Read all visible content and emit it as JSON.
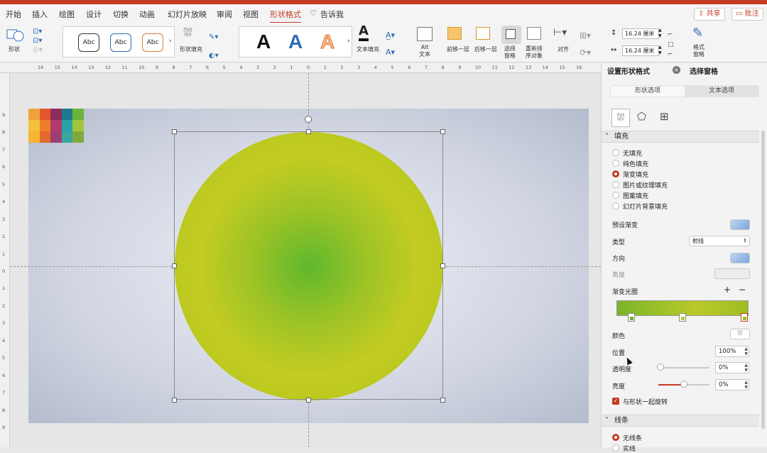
{
  "menu": {
    "tabs": [
      "开始",
      "插入",
      "绘图",
      "设计",
      "切换",
      "动画",
      "幻灯片放映",
      "审阅",
      "视图",
      "形状格式",
      "告诉我"
    ],
    "active_tab": "形状格式",
    "share_label": "共享",
    "comment_label": "批注"
  },
  "ribbon": {
    "shape_label": "形状",
    "style_samples": [
      "Abc",
      "Abc",
      "Abc"
    ],
    "shape_fill_label": "形状填充",
    "wordart_sample": "A",
    "text_fill_label": "文本填充",
    "alt_text_label": "Alt\n文本",
    "bring_forward_label": "前移一层",
    "send_backward_label": "后移一层",
    "selection_pane_label": "选择\n窗格",
    "reorder_label": "重新排\n序对象",
    "align_label": "对齐",
    "height_value": "16.24 厘米",
    "width_value": "16.24 厘米",
    "format_pane_label": "格式\n窗格"
  },
  "ruler": {
    "h_numbers": [
      "16",
      "15",
      "14",
      "13",
      "12",
      "11",
      "10",
      "9",
      "8",
      "7",
      "6",
      "5",
      "4",
      "3",
      "2",
      "1",
      "0",
      "1",
      "2",
      "3",
      "4",
      "5",
      "6",
      "7",
      "8",
      "9",
      "10",
      "11",
      "12",
      "13",
      "14",
      "15",
      "16"
    ],
    "v_numbers": [
      "9",
      "8",
      "7",
      "6",
      "5",
      "4",
      "3",
      "2",
      "1",
      "0",
      "1",
      "2",
      "3",
      "4",
      "5",
      "6",
      "7",
      "8",
      "9"
    ]
  },
  "slide": {
    "palette_colors": [
      "#f0a23a",
      "#e4572e",
      "#8e2c5e",
      "#1d7a8c",
      "#6bb33a",
      "#f3c13a",
      "#ef7d2a",
      "#b03a6b",
      "#2aa0a8",
      "#a2c63b",
      "#f7b531",
      "#e36a2d",
      "#9b3f72",
      "#3aa5a0",
      "#7faa3a"
    ],
    "circle_center_color": "#5fb82d",
    "circle_edge_color": "#c4cc22"
  },
  "panel": {
    "title": "设置形状格式",
    "selection_pane_tab": "选择窗格",
    "shape_options_tab": "形状选项",
    "text_options_tab": "文本选项",
    "fill_section": "填充",
    "fill_options": [
      "无填充",
      "纯色填充",
      "渐变填充",
      "图片或纹理填充",
      "图案填充",
      "幻灯片背景填充"
    ],
    "selected_fill": "渐变填充",
    "preset_gradient_label": "预设渐变",
    "type_label": "类型",
    "type_value": "射线",
    "direction_label": "方向",
    "angle_label": "角度",
    "gradient_stops_label": "渐变光圈",
    "gradient_stop_colors": [
      "#6db52e",
      "#c2c92b",
      "#9dbf25"
    ],
    "color_label": "颜色",
    "position_label": "位置",
    "position_value": "100%",
    "transparency_label": "透明度",
    "transparency_value": "0%",
    "brightness_label": "亮度",
    "brightness_value": "0%",
    "rotate_with_shape_label": "与形状一起旋转",
    "line_section": "线条",
    "line_options": [
      "无线条",
      "实线"
    ],
    "accent_color": "#c23b22"
  }
}
